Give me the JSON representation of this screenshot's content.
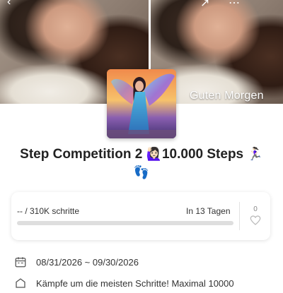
{
  "hero": {
    "overlay_text": "Guten Morgen"
  },
  "event": {
    "title_part1": "Step Competition 2 ",
    "emoji_1": "🙋🏻‍♀️",
    "title_part2": "10.000 Steps ",
    "emoji_2": "🏃🏻‍♀️",
    "emoji_3": "👣"
  },
  "progress": {
    "label": "-- / 310K schritte",
    "days_label": "In 13 Tagen",
    "fraction": 0,
    "like_count": "0"
  },
  "details": {
    "date_range": "08/31/2026 ~ 09/30/2026",
    "description": "Kämpfe um die meisten Schritte! Maximal 10000"
  },
  "colors": {
    "progress_fill": "#9bd16a",
    "progress_track": "#dedede"
  },
  "icons": [
    "back-icon",
    "share-icon",
    "more-icon",
    "heart-icon",
    "calendar-icon",
    "description-icon"
  ]
}
